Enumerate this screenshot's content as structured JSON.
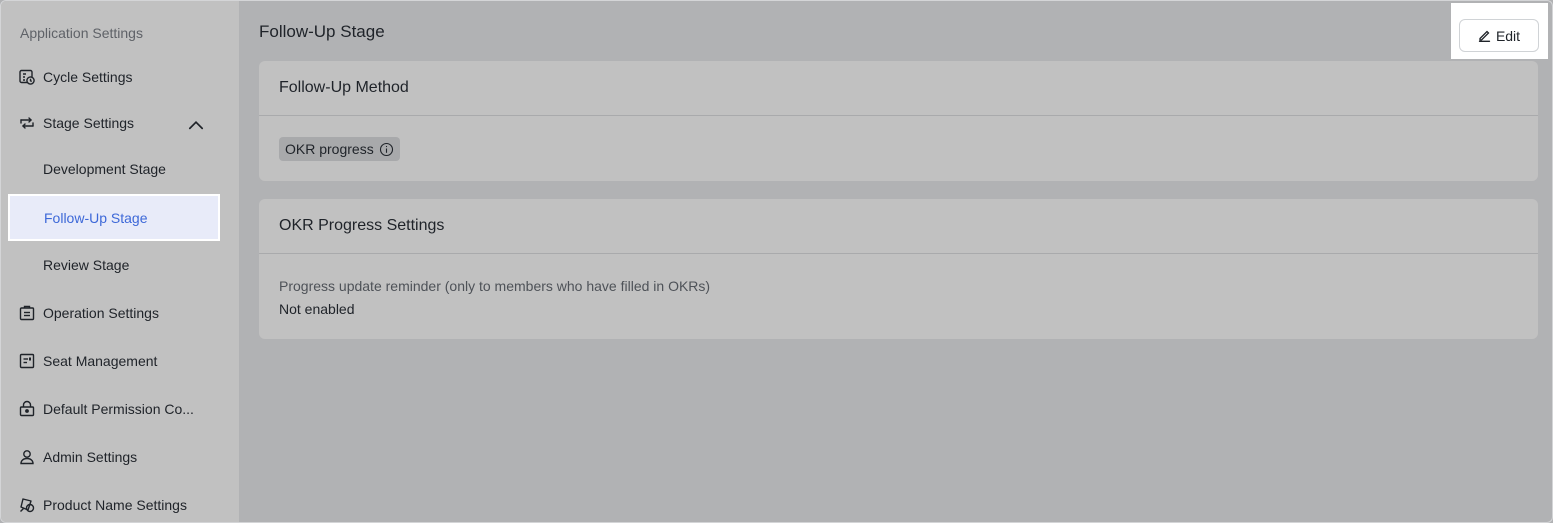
{
  "sidebar": {
    "section_title": "Application Settings",
    "items": [
      {
        "label": "Cycle Settings",
        "icon": "calendar-clock-icon"
      },
      {
        "label": "Stage Settings",
        "icon": "stage-flow-icon"
      },
      {
        "label": "Development Stage"
      },
      {
        "label": "Follow-Up Stage",
        "active": true
      },
      {
        "label": "Review Stage"
      },
      {
        "label": "Operation Settings",
        "icon": "clipboard-icon"
      },
      {
        "label": "Seat Management",
        "icon": "seat-card-icon"
      },
      {
        "label": "Default Permission Co...",
        "icon": "lock-icon"
      },
      {
        "label": "Admin Settings",
        "icon": "user-icon"
      },
      {
        "label": "Product Name Settings",
        "icon": "product-name-icon"
      }
    ]
  },
  "main": {
    "title": "Follow-Up Stage",
    "edit_label": "Edit",
    "method_card": {
      "title": "Follow-Up Method",
      "tag": "OKR progress"
    },
    "progress_card": {
      "title": "OKR Progress Settings",
      "field_label": "Progress update reminder (only to members who have filled in OKRs)",
      "field_value": "Not enabled"
    }
  },
  "colors": {
    "active_text": "#3d68d8",
    "active_bg": "#e8ebf9"
  }
}
